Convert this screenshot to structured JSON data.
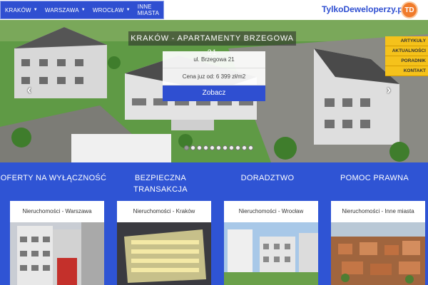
{
  "nav": {
    "items": [
      {
        "label": "KRAKÓW",
        "dropdown": true
      },
      {
        "label": "WARSZAWA",
        "dropdown": true
      },
      {
        "label": "WROCŁAW",
        "dropdown": true
      },
      {
        "label": "INNE MIASTA",
        "dropdown": false
      }
    ]
  },
  "logo": {
    "text": "TylkoDeweloperzy.pl",
    "badge": "TD"
  },
  "hero": {
    "title": "KRAKÓW - APARTAMENTY BRZEGOWA 21",
    "address": "ul. Brzegowa 21",
    "price": "Cena juz od: 6 399 zł/m2",
    "button": "Zobacz",
    "prev": "‹",
    "next": "›",
    "slides_count": 11,
    "active_slide": 1
  },
  "side_menu": {
    "items": [
      "ARTYKUŁY",
      "AKTUALNOŚCI",
      "PORADNIK",
      "KONTAKT"
    ]
  },
  "features": [
    {
      "title": "OFERTY NA WYŁĄCZNOŚĆ",
      "card": "Nieruchomości - Warszawa"
    },
    {
      "title": "BEZPIECZNA TRANSAKCJA",
      "card": "Nieruchomości - Kraków"
    },
    {
      "title": "DORADZTWO",
      "card": "Nieruchomości - Wrocław"
    },
    {
      "title": "POMOC PRAWNA",
      "card": "Nieruchomości - Inne miasta"
    }
  ],
  "colors": {
    "brand_blue": "#2f54d4",
    "accent_yellow": "#f5c21b",
    "logo_orange": "#f07b2b"
  }
}
